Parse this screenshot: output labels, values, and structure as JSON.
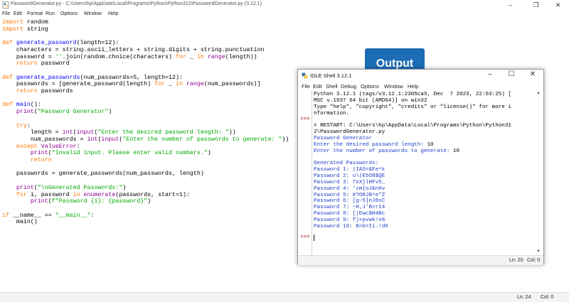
{
  "editor_window": {
    "title": "PasswordGenerator.py - C:\\Users\\hp\\AppData\\Local\\Programs\\Python\\Python312\\PasswordGenerator.py (3.12.1)",
    "menu": [
      "File",
      "Edit",
      "Format",
      "Run",
      "Options",
      "Window",
      "Help"
    ],
    "code": {
      "l1_kw": "import",
      "l1_rest": " random",
      "l2_kw": "import",
      "l2_rest": " string",
      "l4_kw": "def",
      "l4_fn": "generate_password",
      "l4_rest": "(length=12):",
      "l5": "    characters = string.ascii_letters + string.digits + string.punctuation",
      "l6_a": "    password = ",
      "l6_s": "''",
      "l6_b": ".join(random.choice(characters) ",
      "l6_for": "for",
      "l6_c": " _ ",
      "l6_in": "in",
      "l6_d": " ",
      "l6_range": "range",
      "l6_e": "(length))",
      "l7_kw": "    return",
      "l7_rest": " password",
      "l9_kw": "def",
      "l9_fn": "generate_passwords",
      "l9_rest": "(num_passwords=5, length=12):",
      "l10_a": "    passwords = [generate_password(length) ",
      "l10_for": "for",
      "l10_b": " _ ",
      "l10_in": "in",
      "l10_c": " ",
      "l10_range": "range",
      "l10_d": "(num_passwords)]",
      "l11_kw": "    return",
      "l11_rest": " passwords",
      "l13_kw": "def",
      "l13_fn": "main",
      "l13_rest": "():",
      "l14_bi": "    print",
      "l14_a": "(",
      "l14_s": "\"Password Generator\"",
      "l14_b": ")",
      "l16_kw": "    try",
      "l16_rest": ":",
      "l17_a": "        length = ",
      "l17_int": "int",
      "l17_b": "(",
      "l17_input": "input",
      "l17_c": "(",
      "l17_s": "\"Enter the desired password length: \"",
      "l17_d": "))",
      "l18_a": "        num_passwords = ",
      "l18_int": "int",
      "l18_b": "(",
      "l18_input": "input",
      "l18_c": "(",
      "l18_s": "\"Enter the number of passwords to generate: \"",
      "l18_d": "))",
      "l19_kw": "    except",
      "l19_a": " ",
      "l19_bi": "ValueError",
      "l19_b": ":",
      "l20_bi": "        print",
      "l20_a": "(",
      "l20_s": "\"Invalid input. Please enter valid numbers.\"",
      "l20_b": ")",
      "l21_kw": "        return",
      "l23": "    passwords = generate_passwords(num_passwords, length)",
      "l25_bi": "    print",
      "l25_a": "(",
      "l25_s": "\"\\nGenerated Passwords:\"",
      "l25_b": ")",
      "l26_kw": "    for",
      "l26_a": " i, password ",
      "l26_in": "in",
      "l26_b": " ",
      "l26_enum": "enumerate",
      "l26_c": "(passwords, start=1):",
      "l27_bi": "        print",
      "l27_a": "(",
      "l27_s": "f\"Password {i}: {password}\"",
      "l27_b": ")",
      "l29_kw": "if",
      "l29_a": " __name__ == ",
      "l29_s": "\"__main__\"",
      "l29_b": ":",
      "l30": "    main()"
    },
    "status": {
      "line": "Ln: 24",
      "col": "Col: 0"
    }
  },
  "output_badge": "Output",
  "shell_window": {
    "title": "IDLE Shell 3.12.1",
    "menu": [
      "File",
      "Edit",
      "Shell",
      "Debug",
      "Options",
      "Window",
      "Help"
    ],
    "prompt": ">>>",
    "banner_1": "Python 3.12.1 (tags/v3.12.1:2305ca5, Dec  7 2023, 22:03:25) [",
    "banner_2": "MSC v.1937 64 bit (AMD64)] on win32",
    "banner_3": "Type \"help\", \"copyright\", \"credits\" or \"license()\" for more i",
    "banner_4": "nformation.",
    "restart_1": "= RESTART: C:\\Users\\hp\\AppData\\Local\\Programs\\Python\\Python31",
    "restart_2": "2\\PasswordGenerator.py",
    "out_title": "Password Generator",
    "out_len_prompt": "Enter the desired password length: ",
    "out_len_value": "10",
    "out_num_prompt": "Enter the number of passwords to generate: ",
    "out_num_value": "10",
    "out_generated": "Generated Passwords:",
    "passwords": [
      "Password 1: |IAS<&Fe^k",
      "Password 2: u\\(E5O8$QE",
      "Password 3: ?sX}lHFv5_",
      "Password 4: 'zm{oJ&n0v",
      "Password 5: #?ORJB^e\"Z",
      "Password 6: [g~5]nJ8sC",
      "Password 7: ~H,J'B>r14",
      "Password 8: [|Ewc$H4Bc",
      "Password 9: f)+pvwk!x%",
      "Password 10: B>b=Ii.!d#"
    ],
    "status": {
      "line": "Ln: 20",
      "col": "Col: 0"
    }
  }
}
